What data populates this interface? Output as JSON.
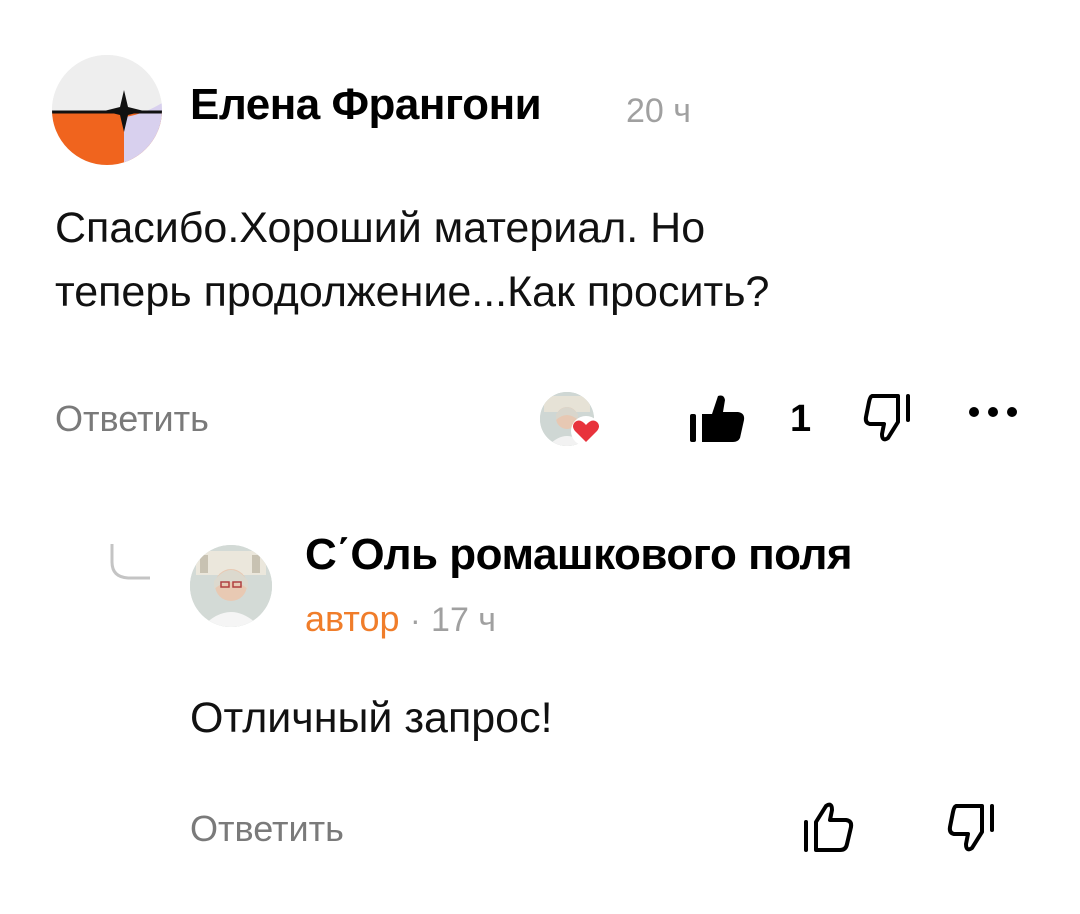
{
  "comment": {
    "author": "Елена Франгони",
    "time": "20 ч",
    "text_line1": "Спасибо.Хороший материал. Но",
    "text_line2": "теперь продолжение...Как просить?",
    "reply_label": "Ответить",
    "like_count": "1",
    "avatar_icon": "sparkle-logo-icon",
    "reaction_icon": "author-heart-reaction-icon"
  },
  "reply": {
    "author": "С΄Оль ромашкового поля",
    "badge": "автор",
    "separator": "·",
    "time": "17 ч",
    "text": "Отличный запрос!",
    "reply_label": "Ответить"
  },
  "colors": {
    "accent_orange": "#f0641e",
    "author_badge": "#f07d2a",
    "muted_text": "#a0a0a0",
    "heart_red": "#e8333c"
  }
}
